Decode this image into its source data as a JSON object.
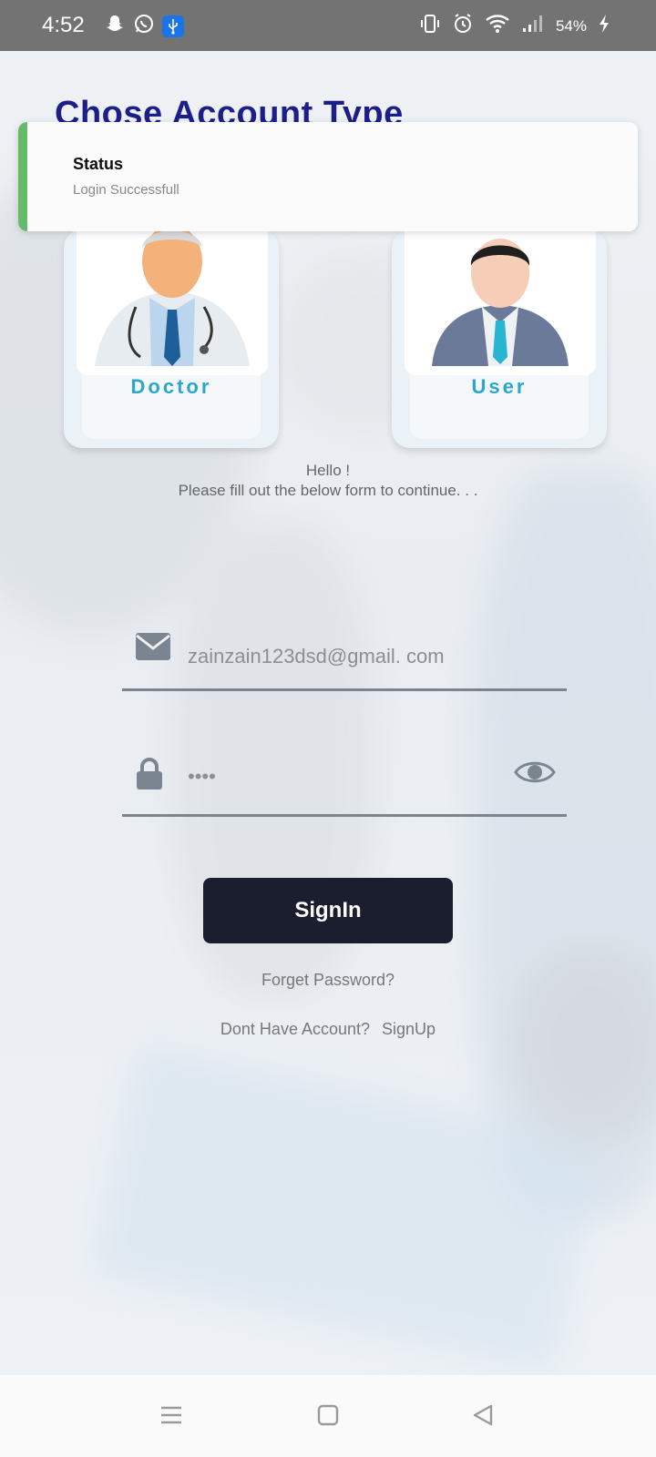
{
  "status_bar": {
    "time": "4:52",
    "battery": "54%",
    "icons": [
      "snapchat-icon",
      "whatsapp-icon",
      "usb-icon",
      "vibrate-icon",
      "alarm-icon",
      "wifi-icon",
      "signal-icon",
      "charging-icon"
    ]
  },
  "page": {
    "title": "Chose Account Type"
  },
  "toast": {
    "title": "Status",
    "message": "Login Successfull",
    "accent_color": "#66bb6a"
  },
  "account_types": [
    {
      "label": "Doctor",
      "icon": "doctor-avatar-icon"
    },
    {
      "label": "User",
      "icon": "user-avatar-icon"
    }
  ],
  "greeting": {
    "line1": "Hello !",
    "line2": "Please fill out the below form to continue. . ."
  },
  "form": {
    "email": {
      "value": "zainzain123dsd@gmail. com",
      "icon": "envelope-icon"
    },
    "password": {
      "value": "••••",
      "icon": "lock-icon",
      "toggle_icon": "eye-icon"
    },
    "signin_label": "SignIn",
    "forget_label": "Forget Password?",
    "no_account_label": "Dont Have Account?",
    "signup_label": "SignUp"
  },
  "colors": {
    "title": "#1c1f8a",
    "card_label": "#2da6c8",
    "button_bg": "#1a1d2e"
  },
  "nav": [
    "menu-icon",
    "home-icon",
    "back-icon"
  ]
}
